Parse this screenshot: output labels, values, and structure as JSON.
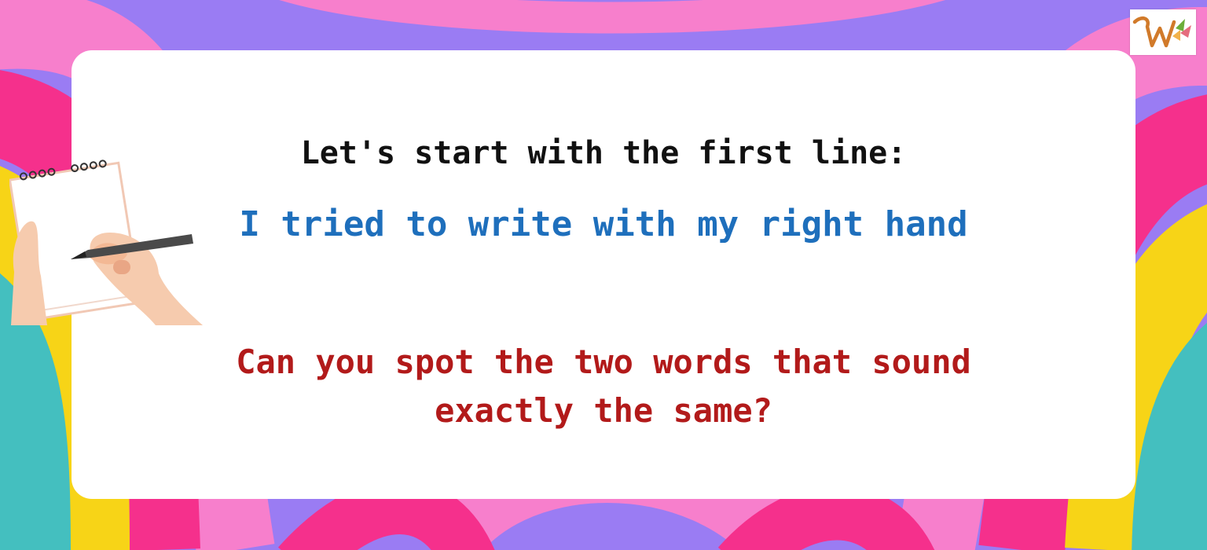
{
  "slide": {
    "intro": "Let's start with the first line:",
    "sentence": "I tried to write with my right hand",
    "question_line1": "Can you spot the two words that sound",
    "question_line2": "exactly the same?"
  },
  "icons": {
    "illustration": "hand-writing-on-notepad-icon",
    "logo": "brand-logo-icon"
  },
  "colors": {
    "intro": "#111111",
    "sentence": "#1e6fbc",
    "question": "#b21a1a",
    "card": "#ffffff",
    "background_stripes": [
      "#9a7cf3",
      "#f77fcc",
      "#f5308c",
      "#f7d417",
      "#44bfbf"
    ]
  }
}
